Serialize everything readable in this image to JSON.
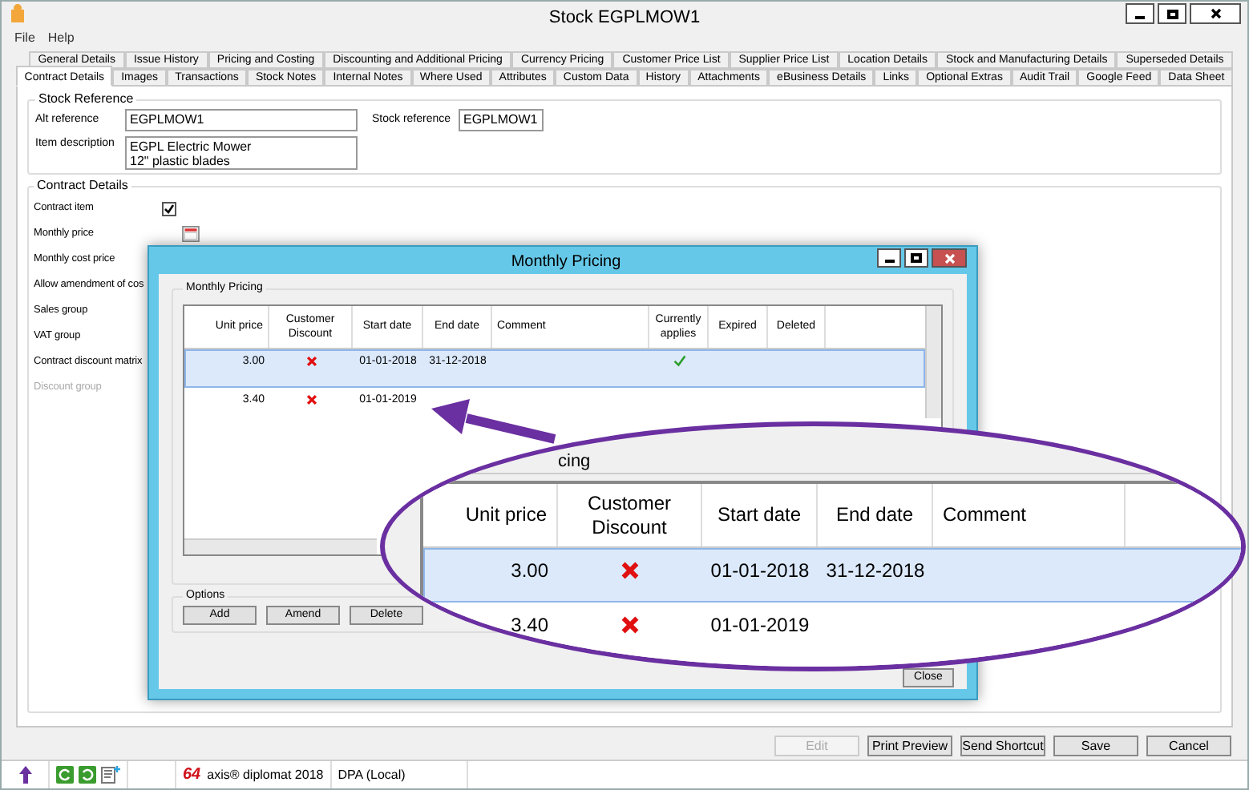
{
  "window": {
    "title": "Stock EGPLMOW1"
  },
  "menu": [
    "File",
    "Help"
  ],
  "tab_rows": [
    [
      {
        "label": "General Details",
        "selected": false
      },
      {
        "label": "Issue History",
        "selected": false
      },
      {
        "label": "Pricing and Costing",
        "selected": false
      },
      {
        "label": "Discounting and Additional Pricing",
        "selected": false
      },
      {
        "label": "Currency Pricing",
        "selected": false
      },
      {
        "label": "Customer Price List",
        "selected": false
      },
      {
        "label": "Supplier Price List",
        "selected": false
      },
      {
        "label": "Location Details",
        "selected": false
      },
      {
        "label": "Stock and Manufacturing Details",
        "selected": false
      },
      {
        "label": "Superseded Details",
        "selected": false
      }
    ],
    [
      {
        "label": "Contract Details",
        "selected": true
      },
      {
        "label": "Images",
        "selected": false
      },
      {
        "label": "Transactions",
        "selected": false
      },
      {
        "label": "Stock Notes",
        "selected": false
      },
      {
        "label": "Internal Notes",
        "selected": false
      },
      {
        "label": "Where Used",
        "selected": false
      },
      {
        "label": "Attributes",
        "selected": false
      },
      {
        "label": "Custom Data",
        "selected": false
      },
      {
        "label": "History",
        "selected": false
      },
      {
        "label": "Attachments",
        "selected": false
      },
      {
        "label": "eBusiness Details",
        "selected": false
      },
      {
        "label": "Links",
        "selected": false
      },
      {
        "label": "Optional Extras",
        "selected": false
      },
      {
        "label": "Audit Trail",
        "selected": false
      },
      {
        "label": "Google Feed",
        "selected": false
      },
      {
        "label": "Data Sheet",
        "selected": false
      }
    ]
  ],
  "stock_reference": {
    "title": "Stock Reference",
    "alt_reference": {
      "label": "Alt reference",
      "value": "EGPLMOW1"
    },
    "stock_reference": {
      "label": "Stock reference",
      "value": "EGPLMOW1"
    },
    "item_description": {
      "label": "Item description",
      "lines": [
        "EGPL Electric Mower",
        "12\" plastic blades"
      ]
    }
  },
  "contract_details": {
    "title": "Contract Details",
    "rows": [
      {
        "label": "Contract item",
        "kind": "checkbox",
        "checked": true,
        "disabled": false
      },
      {
        "label": "Monthly price",
        "kind": "calendar",
        "disabled": false
      },
      {
        "label": "Monthly cost price",
        "kind": "plain",
        "disabled": false
      },
      {
        "label": "Allow amendment of cos",
        "kind": "plain",
        "disabled": false
      },
      {
        "label": "Sales group",
        "kind": "plain",
        "disabled": false
      },
      {
        "label": "VAT group",
        "kind": "plain",
        "disabled": false
      },
      {
        "label": "Contract discount matrix",
        "kind": "plain",
        "disabled": false
      },
      {
        "label": "Discount group",
        "kind": "plain",
        "disabled": true
      }
    ]
  },
  "buttons": [
    {
      "label": "Edit",
      "disabled": true
    },
    {
      "label": "Print Preview",
      "disabled": false
    },
    {
      "label": "Send Shortcut",
      "disabled": false
    },
    {
      "label": "Save",
      "disabled": false
    },
    {
      "label": "Cancel",
      "disabled": false
    }
  ],
  "status_bar": {
    "logo": "64",
    "product": "axis® diplomat 2018",
    "database": "DPA (Local)"
  },
  "dialog": {
    "title": "Monthly Pricing",
    "group_title": "Monthly Pricing",
    "columns": [
      "Unit price",
      "Customer Discount",
      "Start date",
      "End date",
      "Comment",
      "Currently applies",
      "Expired",
      "Deleted"
    ],
    "rows": [
      {
        "unit_price": "3.00",
        "customer_discount": false,
        "start_date": "01-01-2018",
        "end_date": "31-12-2018",
        "currently_applies": true,
        "selected": true
      },
      {
        "unit_price": "3.40",
        "customer_discount": false,
        "start_date": "01-01-2019",
        "end_date": "",
        "currently_applies": false,
        "selected": false
      }
    ],
    "options_title": "Options",
    "option_buttons": [
      "Add",
      "Amend",
      "Delete"
    ],
    "close_button": "Close"
  },
  "magnifier": {
    "caption": "cing",
    "columns": [
      "Unit price",
      "Customer Discount",
      "Start date",
      "End date",
      "Comment"
    ],
    "rows": [
      {
        "unit_price": "3.00",
        "customer_discount": false,
        "start_date": "01-01-2018",
        "end_date": "31-12-2018",
        "selected": true
      },
      {
        "unit_price": "3.40",
        "customer_discount": false,
        "start_date": "01-01-2019",
        "end_date": "",
        "selected": false
      }
    ]
  }
}
